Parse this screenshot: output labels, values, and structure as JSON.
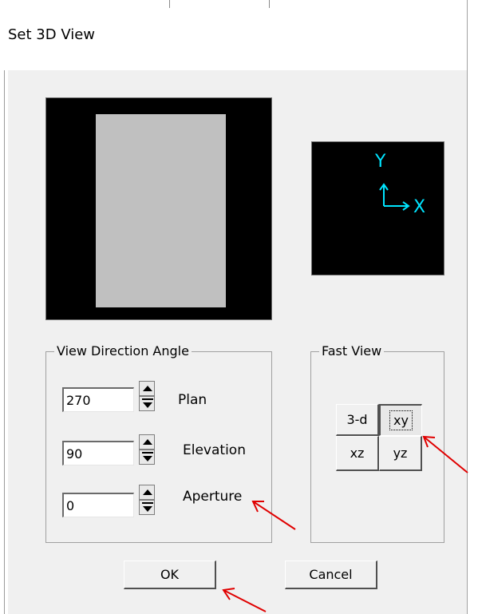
{
  "window": {
    "title": "Set 3D View"
  },
  "view_direction": {
    "group_title": "View Direction Angle",
    "plan": {
      "value": "270",
      "label": "Plan"
    },
    "elevation": {
      "value": "90",
      "label": "Elevation"
    },
    "aperture": {
      "value": "0",
      "label": "Aperture"
    }
  },
  "fast_view": {
    "group_title": "Fast View",
    "btn_3d": "3-d",
    "btn_xy": "xy",
    "btn_xz": "xz",
    "btn_yz": "yz",
    "selected": "xy"
  },
  "axes": {
    "y": "Y",
    "x": "X"
  },
  "buttons": {
    "ok": "OK",
    "cancel": "Cancel"
  },
  "colors": {
    "preview_bg": "#000000",
    "preview_shape": "#c0c0c0",
    "axis_color": "#00e5ff",
    "annotation_arrow": "#e00000"
  },
  "icons": [
    "spin-up-icon",
    "spin-down-icon",
    "axis-triad-icon",
    "red-arrow-icon"
  ]
}
